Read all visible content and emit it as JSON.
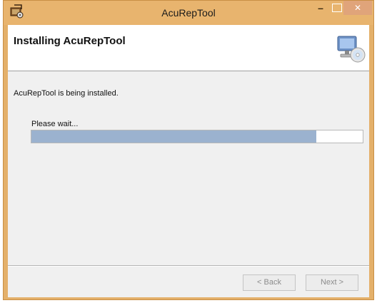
{
  "window": {
    "title": "AcuRepTool",
    "minimize_glyph": "–",
    "close_glyph": "✕",
    "app_icon": "installer-app-icon",
    "accent_color": "#e8b46e"
  },
  "header": {
    "title": "Installing AcuRepTool",
    "icon": "computer-cd-icon"
  },
  "body": {
    "message": "AcuRepTool is being installed.",
    "wait_label": "Please wait..."
  },
  "progress": {
    "value_fraction": 0.86
  },
  "buttons": {
    "back_label": "< Back",
    "next_label": "Next >"
  }
}
